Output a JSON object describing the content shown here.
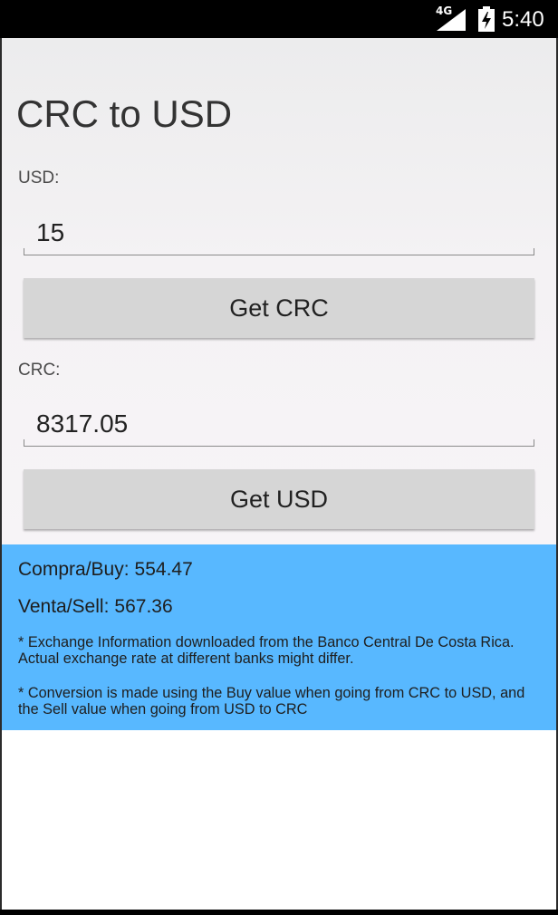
{
  "status_bar": {
    "network": "4G",
    "time": "5:40"
  },
  "app": {
    "title": "CRC to USD"
  },
  "usd_section": {
    "label": "USD:",
    "value": "15",
    "button_label": "Get CRC"
  },
  "crc_section": {
    "label": "CRC:",
    "value": "8317.05",
    "button_label": "Get USD"
  },
  "rates": {
    "buy_label": "Compra/Buy:",
    "buy_value": "554.47",
    "sell_label": "Venta/Sell:",
    "sell_value": "567.36"
  },
  "notes": {
    "source": "* Exchange Information downloaded from the Banco Central De Costa Rica. Actual exchange rate at different banks might differ.",
    "conversion": "* Conversion is made using the Buy value when going from CRC to USD, and the Sell value when going from USD to CRC"
  },
  "colors": {
    "info_panel": "#58b8ff",
    "button": "#d6d6d6",
    "status_bar": "#000000"
  },
  "icons": {
    "signal": "signal-icon",
    "battery": "battery-charging-icon"
  }
}
